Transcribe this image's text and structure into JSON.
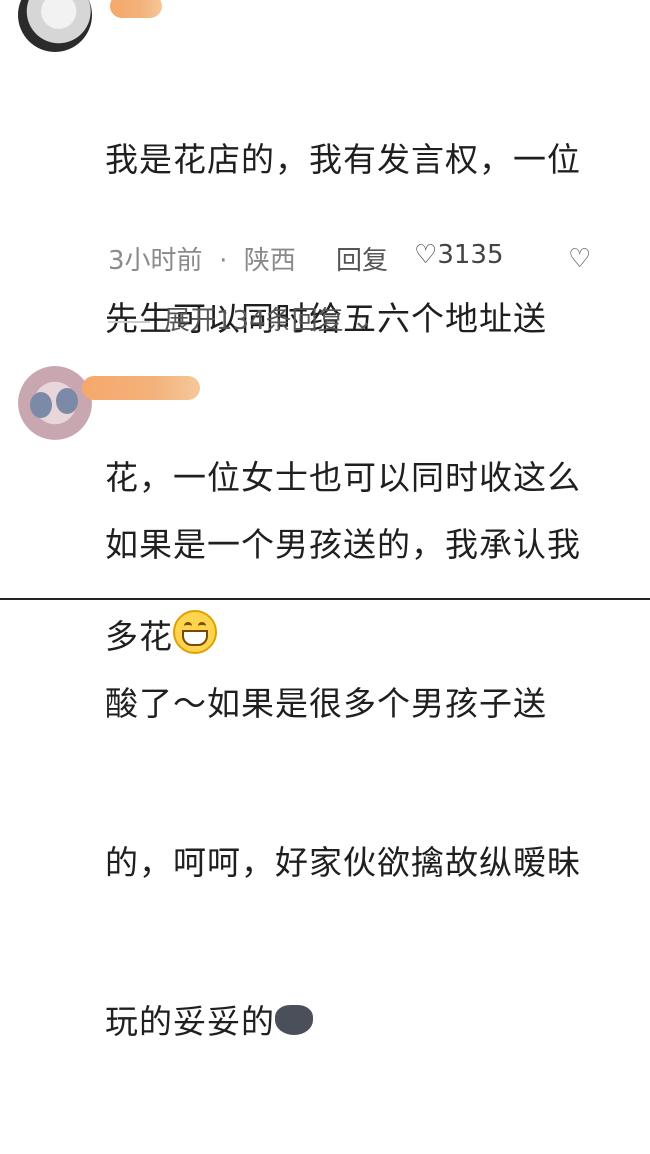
{
  "comments": [
    {
      "text_lines": [
        "我是花店的，我有发言权，一位",
        "先生可以同时给五六个地址送",
        "花，一位女士也可以同时收这么",
        "多花"
      ],
      "emoji": "grinning-face-icon",
      "time": "3小时前",
      "location": "陕西",
      "reply_label": "回复",
      "likes": "3135",
      "expand_label": "展开134条回复"
    },
    {
      "text_lines": [
        "如果是一个男孩送的，我承认我",
        "酸了～如果是很多个男孩子送",
        "的，呵呵，好家伙欲擒故纵暧昧",
        "玩的妥妥的"
      ],
      "emoji": "wolf-face-icon"
    }
  ],
  "colors": {
    "redact": "#f6a86b",
    "meta": "#8a8a8a"
  }
}
